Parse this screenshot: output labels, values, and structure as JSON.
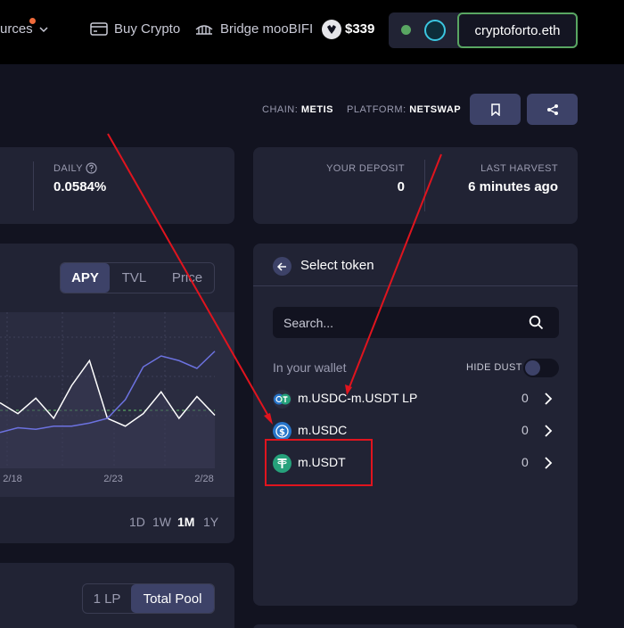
{
  "nav": {
    "resources_label": "urces",
    "buy_crypto_label": "Buy Crypto",
    "bridge_label": "Bridge mooBIFI",
    "price_label": "$339",
    "wallet_address": "cryptoforto.eth"
  },
  "vault": {
    "chain_key": "CHAIN:",
    "chain_value": "METIS",
    "platform_key": "PLATFORM:",
    "platform_value": "NETSWAP"
  },
  "stats": {
    "daily_label": "DAILY",
    "daily_value": "0.0584%",
    "deposit_label": "YOUR DEPOSIT",
    "deposit_value": "0",
    "harvest_label": "LAST HARVEST",
    "harvest_value": "6 minutes ago"
  },
  "chart": {
    "tabs": [
      "APY",
      "TVL",
      "Price"
    ],
    "active_tab": "APY",
    "ranges": [
      "1D",
      "1W",
      "1M",
      "1Y"
    ],
    "active_range": "1M"
  },
  "chart_data": {
    "type": "line",
    "x": [
      "2/18",
      "2/23",
      "2/28"
    ],
    "title": "",
    "xlabel": "",
    "ylabel": "",
    "grid": true,
    "series": [
      {
        "values": [
          0.42,
          0.35,
          0.45,
          0.32,
          0.53,
          0.69,
          0.32,
          0.27,
          0.35,
          0.49,
          0.32,
          0.46,
          0.34
        ]
      },
      {
        "values": [
          0.23,
          0.26,
          0.25,
          0.27,
          0.27,
          0.29,
          0.32,
          0.44,
          0.65,
          0.72,
          0.69,
          0.64,
          0.75
        ]
      }
    ]
  },
  "liquidity": {
    "tabs": [
      "1 LP",
      "Total Pool"
    ],
    "active_tab": "Total Pool"
  },
  "token_select": {
    "title": "Select token",
    "search_placeholder": "Search...",
    "wallet_label": "In your wallet",
    "hide_dust_label": "HIDE DUST",
    "tokens": [
      {
        "name": "m.USDC-m.USDT LP",
        "balance": "0"
      },
      {
        "name": "m.USDC",
        "balance": "0"
      },
      {
        "name": "m.USDT",
        "balance": "0"
      }
    ]
  },
  "colors": {
    "accent_green": "#59a662",
    "annotation_red": "#e0141e",
    "usdc_blue": "#2775ca",
    "usdt_green": "#26a17b"
  }
}
